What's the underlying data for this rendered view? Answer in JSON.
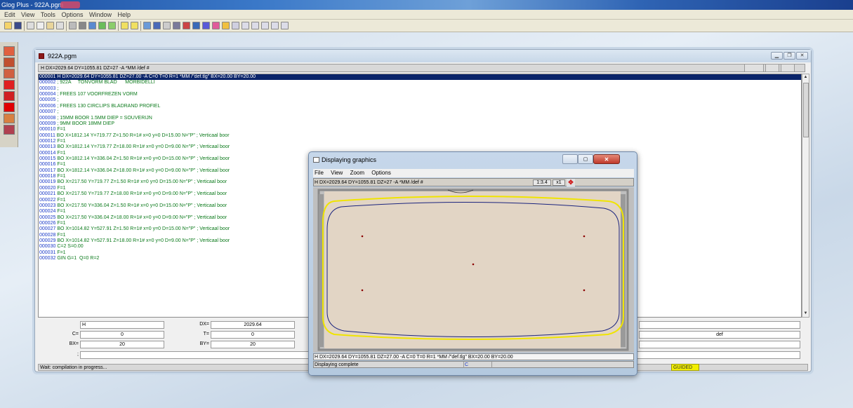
{
  "app": {
    "title": "Glog Plus - 922A.pgm",
    "menu": [
      "Edit",
      "View",
      "Tools",
      "Options",
      "Window",
      "Help"
    ]
  },
  "mdi": {
    "title": "922A.pgm",
    "header": "H DX=2029.64 DY=1055.81 DZ=27 -A *MM /def #",
    "lines": [
      {
        "n": "000001",
        "t": "H DX=2029.64 DY=1055.81 DZ=27.00 -A C=0 T=0 R=1 *MM /\"def.tlg\" BX=20.00 BY=20.00",
        "selected": true
      },
      {
        "n": "000002",
        "t": "; 922A     TONVORM BLAD      MORBIDELLI"
      },
      {
        "n": "000003",
        "t": ";"
      },
      {
        "n": "000004",
        "t": "; FREES 107 VOORFREZEN VORM"
      },
      {
        "n": "000005",
        "t": ";"
      },
      {
        "n": "000006",
        "t": "; FREES 130 CIRCLIPS BLADRAND PROFIEL"
      },
      {
        "n": "000007",
        "t": ";"
      },
      {
        "n": "000008",
        "t": "; 15MM BOOR 1.5MM DIEP = SOUVERIJN"
      },
      {
        "n": "000009",
        "t": "; 9MM BOOR 18MM DIEP"
      },
      {
        "n": "000010",
        "t": "F=1"
      },
      {
        "n": "000011",
        "t": "BO X=1812.14 Y=719.77 Z=1.50 R=1# x=0 y=0 D=15.00 N=\"P\" ; Verticaal boor"
      },
      {
        "n": "000012",
        "t": "F=1"
      },
      {
        "n": "000013",
        "t": "BO X=1812.14 Y=719.77 Z=18.00 R=1# x=0 y=0 D=9.00 N=\"P\" ; Verticaal boor"
      },
      {
        "n": "000014",
        "t": "F=1"
      },
      {
        "n": "000015",
        "t": "BO X=1812.14 Y=336.04 Z=1.50 R=1# x=0 y=0 D=15.00 N=\"P\" ; Verticaal boor"
      },
      {
        "n": "000016",
        "t": "F=1"
      },
      {
        "n": "000017",
        "t": "BO X=1812.14 Y=336.04 Z=18.00 R=1# x=0 y=0 D=9.00 N=\"P\" ; Verticaal boor"
      },
      {
        "n": "000018",
        "t": "F=1"
      },
      {
        "n": "000019",
        "t": "BO X=217.50 Y=719.77 Z=1.50 R=1# x=0 y=0 D=15.00 N=\"P\" ; Verticaal boor"
      },
      {
        "n": "000020",
        "t": "F=1"
      },
      {
        "n": "000021",
        "t": "BO X=217.50 Y=719.77 Z=18.00 R=1# x=0 y=0 D=9.00 N=\"P\" ; Verticaal boor"
      },
      {
        "n": "000022",
        "t": "F=1"
      },
      {
        "n": "000023",
        "t": "BO X=217.50 Y=336.04 Z=1.50 R=1# x=0 y=0 D=15.00 N=\"P\" ; Verticaal boor"
      },
      {
        "n": "000024",
        "t": "F=1"
      },
      {
        "n": "000025",
        "t": "BO X=217.50 Y=336.04 Z=18.00 R=1# x=0 y=0 D=9.00 N=\"P\" ; Verticaal boor"
      },
      {
        "n": "000026",
        "t": "F=1"
      },
      {
        "n": "000027",
        "t": "BO X=1014.82 Y=527.91 Z=1.50 R=1# x=0 y=0 D=15.00 N=\"P\" ; Verticaal boor"
      },
      {
        "n": "000028",
        "t": "F=1"
      },
      {
        "n": "000029",
        "t": "BO X=1014.82 Y=527.91 Z=18.00 R=1# x=0 y=0 D=9.00 N=\"P\" ; Verticaal boor"
      },
      {
        "n": "000030",
        "t": "C=2 S=0.00"
      },
      {
        "n": "000031",
        "t": "F=1"
      },
      {
        "n": "000032",
        "t": "GIN G=1  Q=0 R=2"
      }
    ],
    "params": {
      "h_value": "H",
      "dx_label": "DX=",
      "dx_value": "2029.64",
      "c_label": "C=",
      "c_value": "0",
      "t_label": "T=",
      "t_value": "0",
      "bx_label": "BX=",
      "bx_value": "20",
      "by_label": "BY=",
      "by_value": "20",
      "semicolon_label": ";",
      "def_value": "def"
    },
    "status": "Wait: compilation in progress...",
    "guided": "GUIDED"
  },
  "graphics": {
    "title": "Displaying graphics",
    "menu": [
      "File",
      "View",
      "Zoom",
      "Options"
    ],
    "header": "H DX=2029.64 DY=1055.81 DZ=27 -A *MM /def #",
    "scale": "1:3.4",
    "zoom": "x1",
    "statusline": "H DX=2029.64 DY=1055.81 DZ=27.00 -A C=0 T=0 R=1 *MM /\"def.tlg\" BX=20.00 BY=20.00",
    "bottom_status": "Displaying complete",
    "bottom_mode": "C",
    "colors": {
      "panel": "#e2d5c5",
      "outline": "#1a237e",
      "edge": "#f0e400",
      "drill": "#8b0000"
    }
  }
}
